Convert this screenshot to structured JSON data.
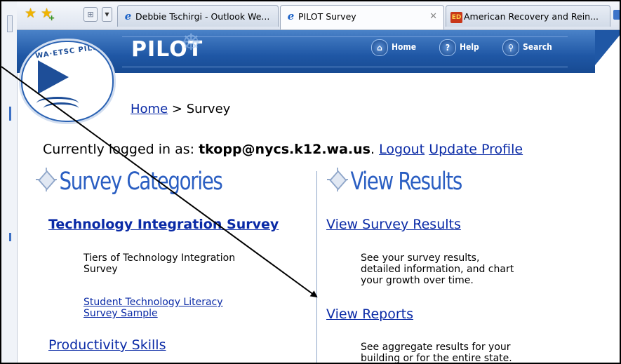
{
  "browser": {
    "tabs": [
      {
        "label": "Debbie Tschirgi - Outlook We...",
        "icon": "ie-icon"
      },
      {
        "label": "PILOT Survey",
        "icon": "ie-icon",
        "active": true
      },
      {
        "label": "American Recovery and Rein...",
        "icon": "ed-gov-icon"
      }
    ],
    "close_glyph": "✕"
  },
  "site": {
    "logo_text": "WA·ETSC PILOT",
    "brand": "PILOT",
    "nav": [
      {
        "label": "Home",
        "icon": "home-icon",
        "glyph": "⌂"
      },
      {
        "label": "Help",
        "icon": "help-icon",
        "glyph": "?"
      },
      {
        "label": "Search",
        "icon": "search-icon",
        "glyph": "⚲"
      }
    ]
  },
  "breadcrumb": {
    "home": "Home",
    "separator": " > ",
    "current": "Survey"
  },
  "session": {
    "prefix": "Currently logged in as: ",
    "user": "tkopp@nycs.k12.wa.us",
    "period": ". ",
    "logout": "Logout",
    "update_profile": "Update Profile"
  },
  "categories": {
    "heading": "Survey Categories",
    "survey1_title": "Technology Integration Survey",
    "survey1_desc": [
      "Tiers of Technology Integration",
      "Survey"
    ],
    "survey1_link": [
      "Student Technology Literacy",
      "Survey Sample"
    ],
    "survey2_title": "Productivity Skills"
  },
  "results": {
    "heading": "View Results",
    "link1": "View Survey Results",
    "desc1": [
      "See your survey results,",
      "detailed information, and chart",
      "your growth over time."
    ],
    "link2": "View Reports",
    "desc2": [
      "See aggregate results for your",
      "building or for the entire state."
    ]
  },
  "colors": {
    "link": "#0a2aa6",
    "heading": "#2a5ec2",
    "header_band": "#1f57a5"
  }
}
